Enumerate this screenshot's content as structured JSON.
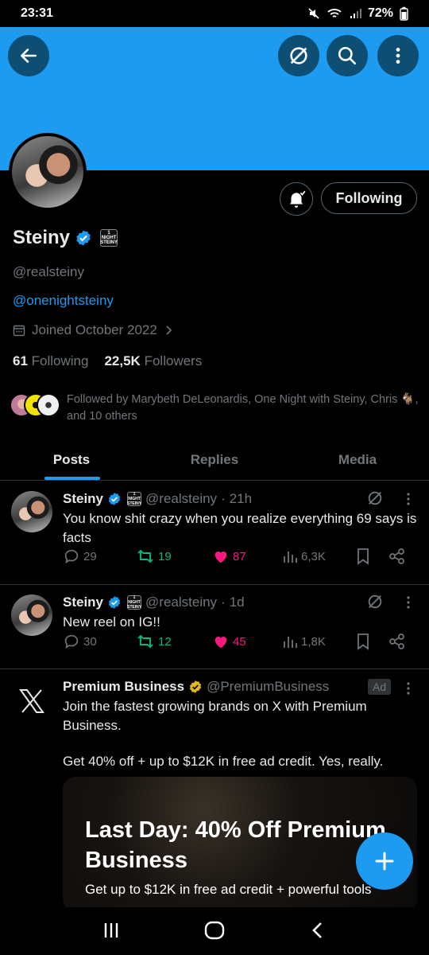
{
  "status": {
    "time": "23:31",
    "battery": "72%"
  },
  "header": {
    "back_icon": "arrow-left-icon",
    "grok_icon": "grok-icon",
    "search_icon": "search-icon",
    "more_icon": "more-vertical-icon",
    "banner_color": "#1d9bf0"
  },
  "profile": {
    "name": "Steiny",
    "affiliate_badge": "1 NIGHT STEINY",
    "handle": "@realsteiny",
    "link": "@onenightsteiny",
    "joined": "Joined October 2022",
    "following_count": "61",
    "following_label": "Following",
    "followers_count": "22,5K",
    "followers_label": "Followers",
    "follow_button": "Following",
    "followed_by": "Followed by Marybeth DeLeonardis, One Night with Steiny, Chris 🐐, and 10 others"
  },
  "tabs": [
    {
      "label": "Posts",
      "active": true
    },
    {
      "label": "Replies",
      "active": false
    },
    {
      "label": "Media",
      "active": false
    }
  ],
  "posts": [
    {
      "name": "Steiny",
      "handle": "@realsteiny",
      "time": "21h",
      "text": "You know shit crazy when you realize everything 69 says is facts",
      "replies": "29",
      "reposts": "19",
      "likes": "87",
      "views": "6,3K"
    },
    {
      "name": "Steiny",
      "handle": "@realsteiny",
      "time": "1d",
      "text": "New reel on IG!!",
      "replies": "30",
      "reposts": "12",
      "likes": "45",
      "views": "1,8K"
    }
  ],
  "ad": {
    "name": "Premium Business",
    "handle": "@PremiumBusiness",
    "tag": "Ad",
    "text1": "Join the fastest growing brands on X with Premium Business.",
    "text2": "Get 40% off + up to $12K in free ad credit. Yes, really.",
    "card_headline": "Last Day: 40% Off Premium Business",
    "card_sub": "Get up to $12K in free ad credit + powerful tools"
  },
  "colors": {
    "accent": "#1d9bf0",
    "like": "#f91880",
    "repost": "#00ba7c",
    "gold": "#e2b719"
  }
}
